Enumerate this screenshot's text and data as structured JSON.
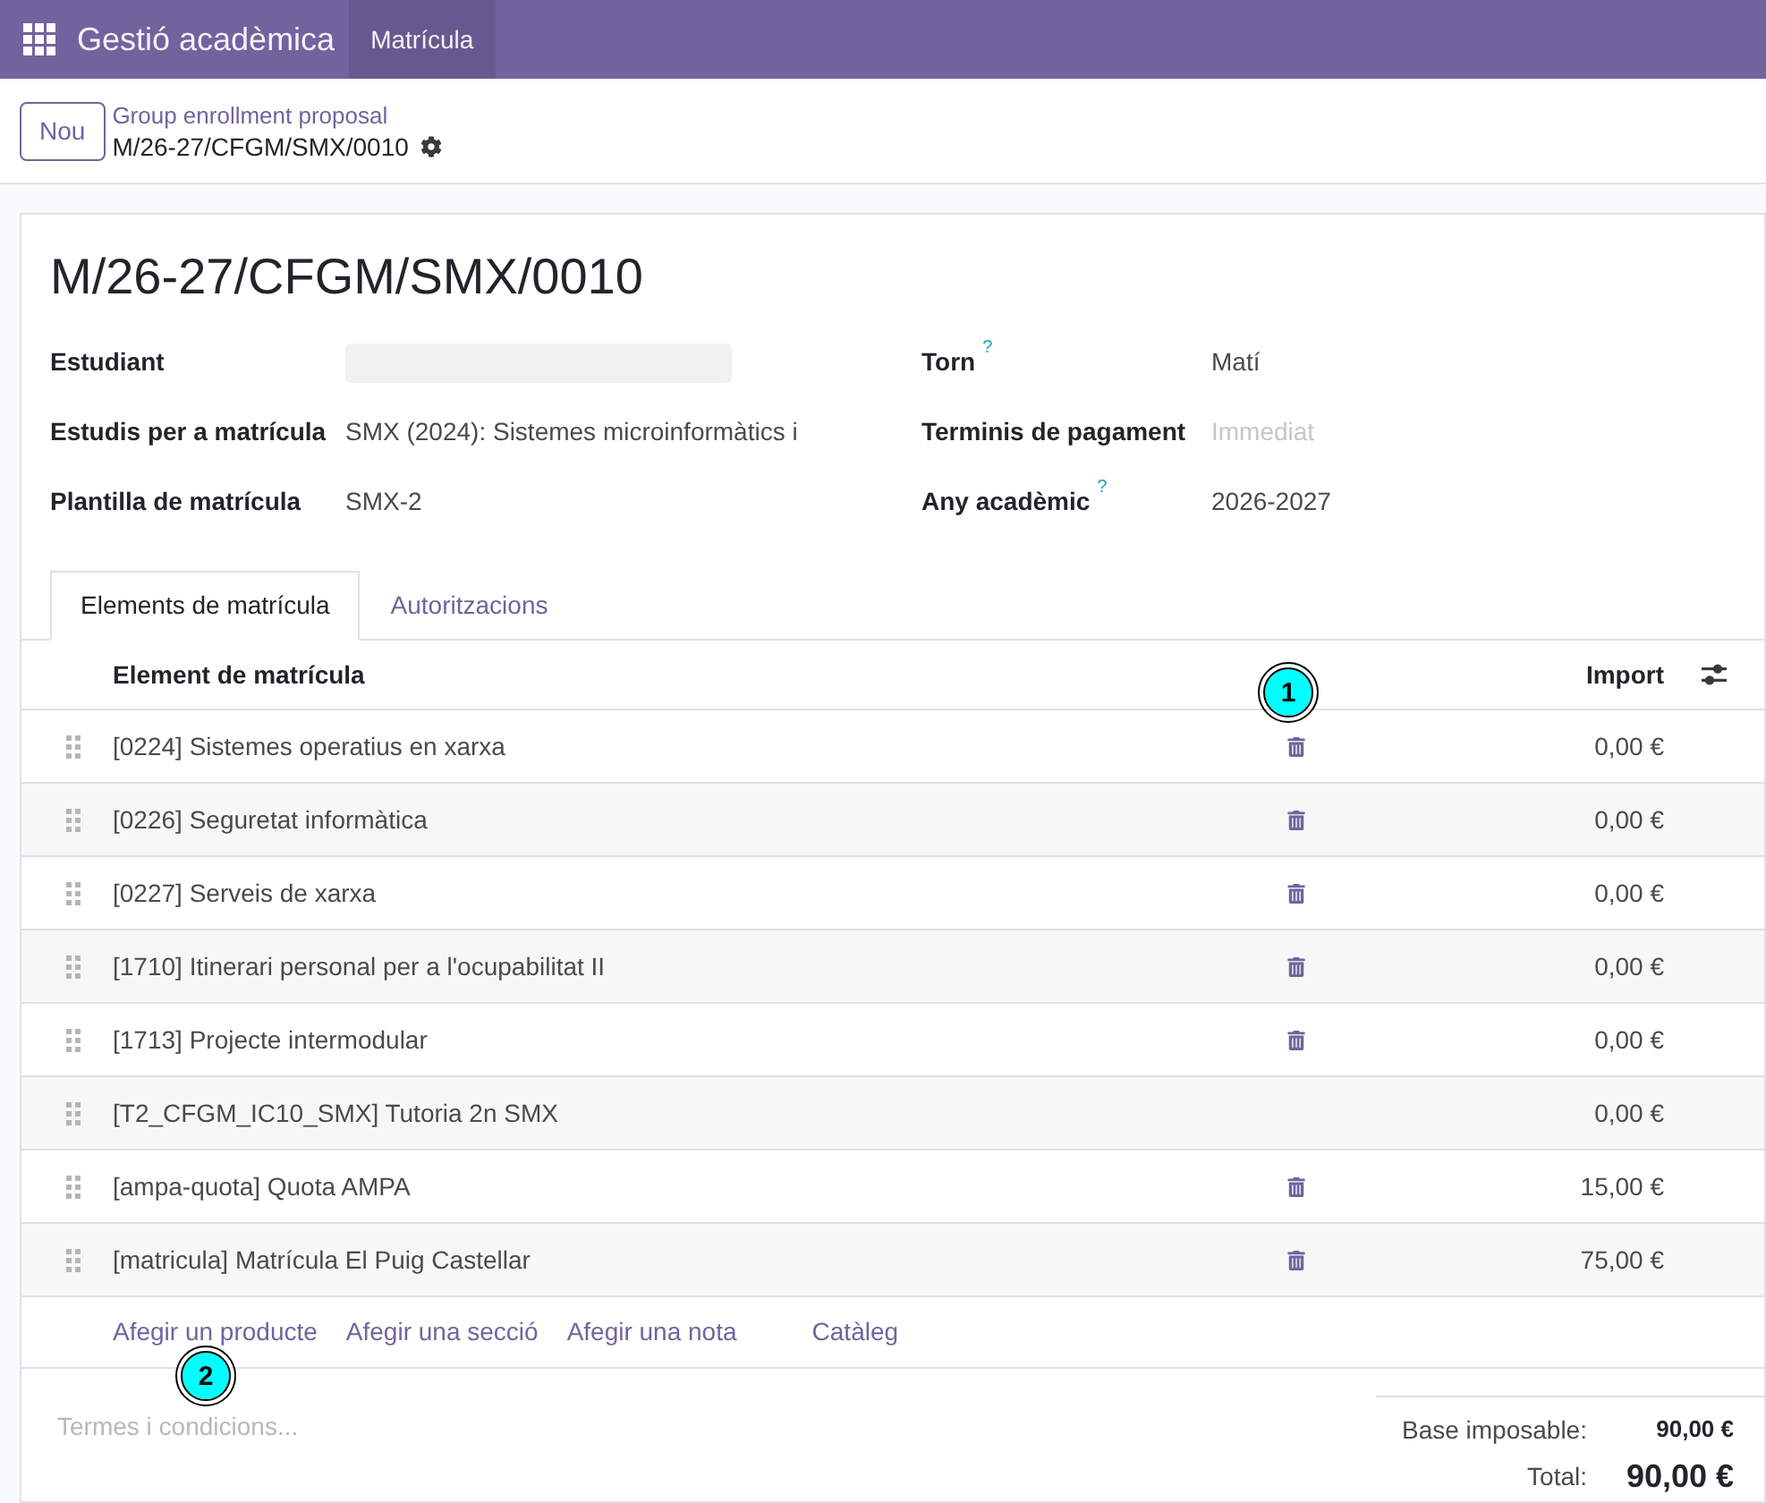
{
  "navbar": {
    "app_title": "Gestió acadèmica",
    "menu": [
      {
        "label": "Matrícula",
        "selected": true
      }
    ]
  },
  "control_panel": {
    "new_button": "Nou",
    "breadcrumb": "Group enrollment proposal",
    "record_name": "M/26-27/CFGM/SMX/0010"
  },
  "form": {
    "title": "M/26-27/CFGM/SMX/0010",
    "left_fields": [
      {
        "label": "Estudiant",
        "kind": "redacted"
      },
      {
        "label": "Estudis per a matrícula",
        "kind": "text",
        "value": "SMX (2024): Sistemes microinformàtics i"
      },
      {
        "label": "Plantilla de matrícula",
        "kind": "text",
        "value": "SMX-2"
      }
    ],
    "right_fields": [
      {
        "label": "Torn",
        "help": "?",
        "kind": "text",
        "value": "Matí"
      },
      {
        "label": "Terminis de pagament",
        "kind": "empty",
        "placeholder": "Immediat"
      },
      {
        "label": "Any acadèmic",
        "help": "?",
        "kind": "text",
        "value": "2026-2027"
      }
    ]
  },
  "tabs": [
    {
      "label": "Elements de matrícula",
      "selected": true
    },
    {
      "label": "Autoritzacions",
      "selected": false
    }
  ],
  "lines": {
    "columns": [
      "Element de matrícula",
      "Import"
    ],
    "rows": [
      {
        "name": "[0224] Sistemes operatius en xarxa",
        "amount": "0,00 €",
        "deletable": true
      },
      {
        "name": "[0226] Seguretat informàtica",
        "amount": "0,00 €",
        "deletable": true
      },
      {
        "name": "[0227] Serveis de xarxa",
        "amount": "0,00 €",
        "deletable": true
      },
      {
        "name": "[1710] Itinerari personal per a l'ocupabilitat II",
        "amount": "0,00 €",
        "deletable": true
      },
      {
        "name": "[1713] Projecte intermodular",
        "amount": "0,00 €",
        "deletable": true
      },
      {
        "name": "[T2_CFGM_IC10_SMX] Tutoria 2n SMX",
        "amount": "0,00 €",
        "deletable": false
      },
      {
        "name": "[ampa-quota] Quota AMPA",
        "amount": "15,00 €",
        "deletable": true
      },
      {
        "name": "[matricula] Matrícula El Puig Castellar",
        "amount": "75,00 €",
        "deletable": true
      }
    ],
    "add_links": [
      "Afegir un producte",
      "Afegir una secció",
      "Afegir una nota",
      "Catàleg"
    ]
  },
  "terms": {
    "placeholder": "Termes i condicions..."
  },
  "totals": [
    {
      "kind": "subtotal",
      "label": "Base imposable:",
      "value": "90,00 €"
    },
    {
      "kind": "total",
      "label": "Total:",
      "value": "90,00 €"
    }
  ],
  "annotations": [
    "1",
    "2"
  ]
}
